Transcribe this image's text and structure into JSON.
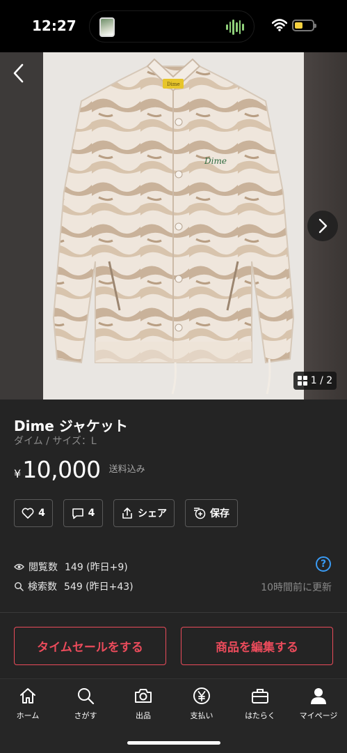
{
  "status_bar": {
    "time": "12:27"
  },
  "photo": {
    "counter": "1 / 2",
    "brand_tag": "Dime",
    "embroidery": "Dime"
  },
  "item": {
    "title": "Dime ジャケット",
    "subtitle": "ダイム / サイズ：L",
    "price_currency": "¥",
    "price": "10,000",
    "shipping": "送料込み"
  },
  "actions": {
    "like_count": "4",
    "comment_count": "4",
    "share_label": "シェア",
    "save_label": "保存"
  },
  "stats": {
    "views_label": "閲覧数",
    "views_value": "149 (昨日+9)",
    "search_label": "検索数",
    "search_value": "549 (昨日+43)",
    "help": "?",
    "updated": "10時間前に更新"
  },
  "buttons": {
    "timesale": "タイムセールをする",
    "edit": "商品を編集する"
  },
  "nav": [
    {
      "label": "ホーム",
      "icon": "home-icon"
    },
    {
      "label": "さがす",
      "icon": "search-icon"
    },
    {
      "label": "出品",
      "icon": "camera-icon"
    },
    {
      "label": "支払い",
      "icon": "yen-icon"
    },
    {
      "label": "はたらく",
      "icon": "briefcase-icon"
    },
    {
      "label": "マイページ",
      "icon": "person-icon"
    }
  ],
  "colors": {
    "background": "#242424",
    "accent_red": "#ea4b5b",
    "help_blue": "#3a9bf4",
    "battery_yellow": "#f4d03f"
  }
}
